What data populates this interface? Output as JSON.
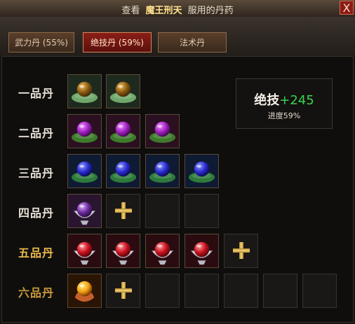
{
  "title": {
    "prefix": "查看",
    "name": "魔王刑天",
    "suffix": "服用的丹药"
  },
  "close_label": "X",
  "tabs": [
    {
      "label": "武力丹 (55%)"
    },
    {
      "label": "绝技丹 (59%)"
    },
    {
      "label": "法术丹"
    }
  ],
  "rows": [
    {
      "label": "一品丹",
      "pill": "pill-grade-1",
      "filled": 2,
      "empty": 0
    },
    {
      "label": "二品丹",
      "pill": "pill-grade-2",
      "filled": 3,
      "empty": 0
    },
    {
      "label": "三品丹",
      "pill": "pill-grade-3",
      "filled": 4,
      "empty": 0
    },
    {
      "label": "四品丹",
      "pill": "pill-grade-4",
      "filled": 1,
      "empty": 3
    },
    {
      "label": "五品丹",
      "pill": "pill-grade-5",
      "filled": 4,
      "empty": 1
    },
    {
      "label": "六品丹",
      "pill": "pill-grade-6",
      "filled": 1,
      "empty": 6
    }
  ],
  "info": {
    "stat": "绝技",
    "bonus": "+245",
    "progress": "进度59%"
  },
  "colors": {
    "active_tab": "#8a1e16",
    "bonus": "#38d44e",
    "gold": "#e9b84a"
  }
}
